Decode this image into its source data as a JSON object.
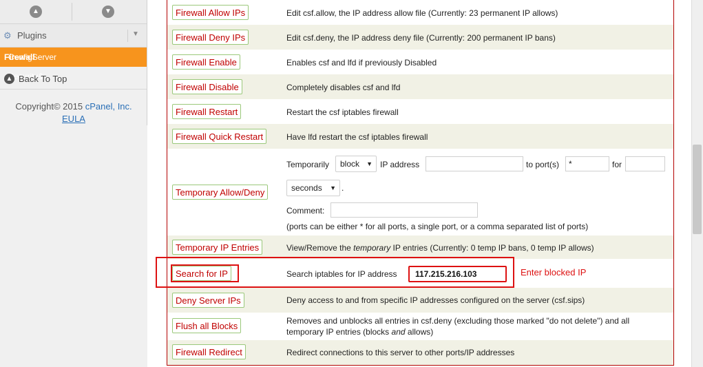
{
  "sidebar": {
    "plugins_label": "Plugins",
    "csf_label_prefix": "ConfigServer Security&",
    "csf_label_bold": "Firewall",
    "back_to_top": "Back To Top",
    "copyright_prefix": "Copyright© 2015",
    "copyright_company": "cPanel, Inc.",
    "eula": "EULA"
  },
  "actions": [
    {
      "button": "Firewall Allow IPs",
      "description": "Edit csf.allow, the IP address allow file (Currently: 23 permanent IP allows)"
    },
    {
      "button": "Firewall Deny IPs",
      "description": "Edit csf.deny, the IP address deny file (Currently: 200 permanent IP bans)"
    },
    {
      "button": "Firewall Enable",
      "description": "Enables csf and lfd if previously Disabled"
    },
    {
      "button": "Firewall Disable",
      "description": "Completely disables csf and lfd"
    },
    {
      "button": "Firewall Restart",
      "description": "Restart the csf iptables firewall"
    },
    {
      "button": "Firewall Quick Restart",
      "description": "Have lfd restart the csf iptables firewall"
    }
  ],
  "temp": {
    "button": "Temporary Allow/Deny",
    "temporarily": "Temporarily",
    "action_value": "block",
    "ip_label": "IP address",
    "ip_value": "",
    "port_label": "to port(s)",
    "port_value": "*",
    "for_label": "for",
    "for_value": "",
    "unit_value": "seconds",
    "period": ".",
    "comment_label": "Comment:",
    "comment_value": "",
    "note": "(ports can be either * for all ports, a single port, or a comma separated list of ports)"
  },
  "entries": {
    "button": "Temporary IP Entries",
    "desc_pre": "View/Remove the",
    "desc_italic": "temporary",
    "desc_post": "IP entries (Currently: 0 temp IP bans, 0 temp IP allows)"
  },
  "search": {
    "button": "Search for IP",
    "label": "Search iptables for IP address",
    "value": "117.215.216.103",
    "annotation": "Enter blocked IP"
  },
  "deny_server": {
    "button": "Deny Server IPs",
    "description": "Deny access to and from specific IP addresses configured on the server (csf.sips)"
  },
  "flush": {
    "button": "Flush all Blocks",
    "line1": "Removes and unblocks all entries in csf.deny (excluding those marked \"do not delete\") and all",
    "line2_pre": "temporary IP entries (blocks",
    "line2_italic": "and",
    "line2_post": "allows)"
  },
  "redirect": {
    "button": "Firewall Redirect",
    "description": "Redirect connections to this server to other ports/IP addresses"
  }
}
